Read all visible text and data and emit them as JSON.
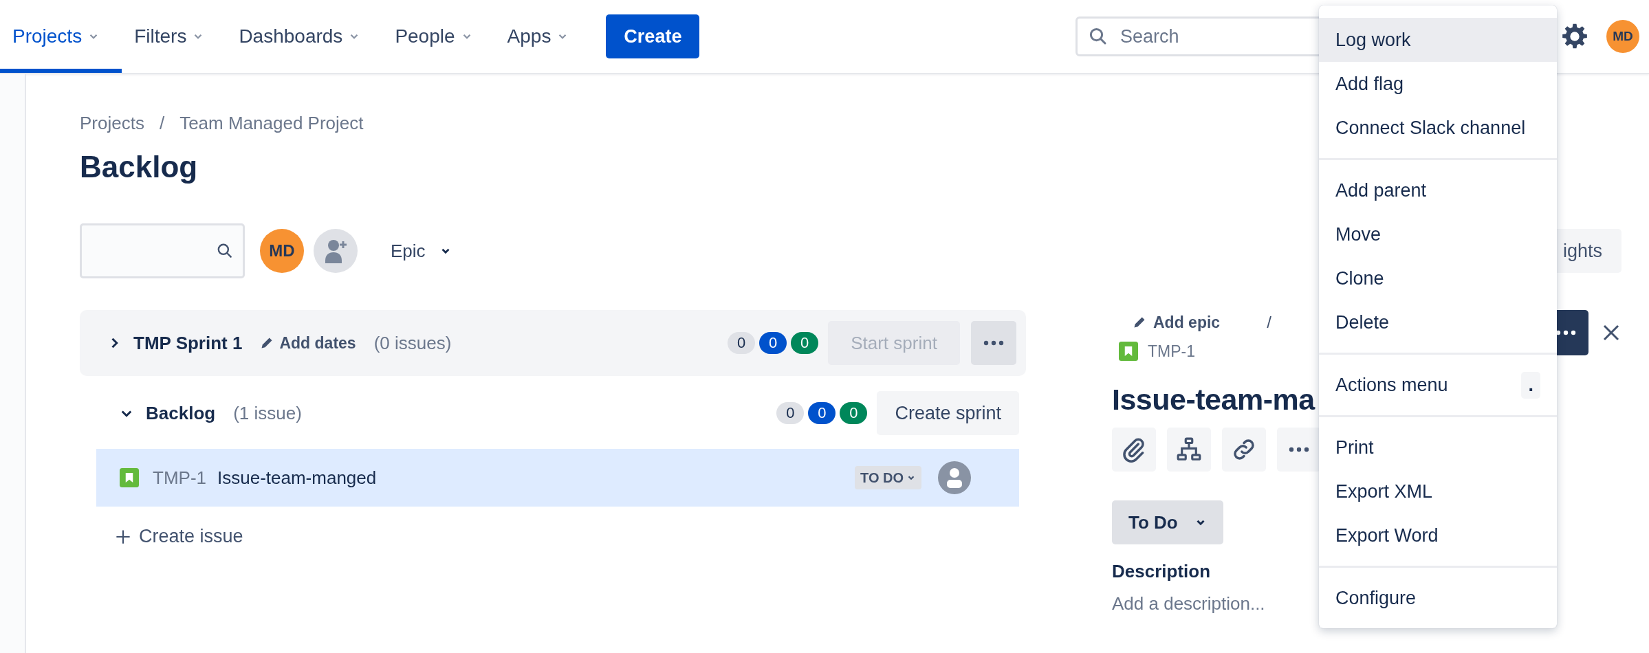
{
  "nav": {
    "items": [
      {
        "label": "Projects",
        "selected": true
      },
      {
        "label": "Filters",
        "selected": false
      },
      {
        "label": "Dashboards",
        "selected": false
      },
      {
        "label": "People",
        "selected": false
      },
      {
        "label": "Apps",
        "selected": false
      }
    ],
    "create": "Create",
    "search": {
      "placeholder": "Search"
    },
    "avatar": "MD"
  },
  "breadcrumb": {
    "items": [
      "Projects",
      "Team Managed Project"
    ],
    "separator": "/"
  },
  "title": "Backlog",
  "toolbar": {
    "avatar": "MD",
    "epic": "Epic",
    "insights": "ights"
  },
  "sprint": {
    "name": "TMP Sprint 1",
    "expanded": false,
    "add_dates": "Add dates",
    "count": "(0 issues)",
    "counts": [
      {
        "value": "0",
        "color": "#dfe1e6"
      },
      {
        "value": "0",
        "color": "#0052cc"
      },
      {
        "value": "0",
        "color": "#00875a"
      }
    ],
    "start": {
      "label": "Start sprint",
      "disabled": true
    }
  },
  "backlog": {
    "name": "Backlog",
    "expanded": true,
    "count": "(1 issue)",
    "counts": [
      {
        "value": "0",
        "color": "#dfe1e6"
      },
      {
        "value": "0",
        "color": "#0052cc"
      },
      {
        "value": "0",
        "color": "#00875a"
      }
    ],
    "create_sprint": "Create sprint",
    "issues": [
      {
        "key": "TMP-1",
        "summary": "Issue-team-manged",
        "status": "TO DO",
        "selected": true
      }
    ],
    "create_issue": "Create issue"
  },
  "detail": {
    "add_epic": "Add epic",
    "separator": "/",
    "key": "TMP-1",
    "title": "Issue-team-ma",
    "status": "To Do",
    "description_label": "Description",
    "description_placeholder": "Add a description..."
  },
  "menu": [
    [
      {
        "label": "Log work",
        "selected": true
      },
      {
        "label": "Add flag",
        "selected": false
      },
      {
        "label": "Connect Slack channel",
        "selected": false
      }
    ],
    [
      {
        "label": "Add parent",
        "selected": false
      },
      {
        "label": "Move",
        "selected": false
      },
      {
        "label": "Clone",
        "selected": false
      },
      {
        "label": "Delete",
        "selected": false
      }
    ],
    [
      {
        "label": "Actions menu",
        "selected": false,
        "shortcut": "."
      }
    ],
    [
      {
        "label": "Print",
        "selected": false
      },
      {
        "label": "Export XML",
        "selected": false
      },
      {
        "label": "Export Word",
        "selected": false
      }
    ],
    [
      {
        "label": "Configure",
        "selected": false
      }
    ]
  ]
}
